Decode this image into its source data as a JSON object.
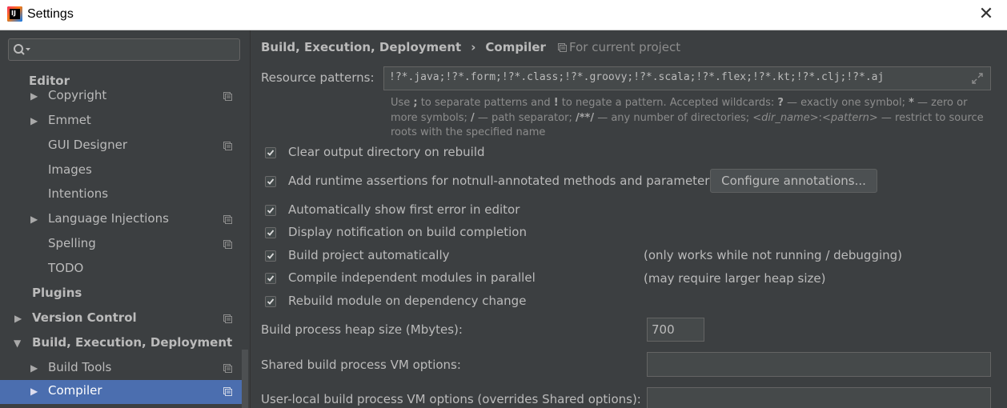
{
  "window": {
    "title": "Settings"
  },
  "search": {
    "placeholder": ""
  },
  "sidebar": {
    "items": [
      {
        "label": "Editor"
      },
      {
        "label": "Copyright"
      },
      {
        "label": "Emmet"
      },
      {
        "label": "GUI Designer"
      },
      {
        "label": "Images"
      },
      {
        "label": "Intentions"
      },
      {
        "label": "Language Injections"
      },
      {
        "label": "Spelling"
      },
      {
        "label": "TODO"
      },
      {
        "label": "Plugins"
      },
      {
        "label": "Version Control"
      },
      {
        "label": "Build, Execution, Deployment"
      },
      {
        "label": "Build Tools"
      },
      {
        "label": "Compiler"
      }
    ],
    "selected": "Compiler"
  },
  "breadcrumb": {
    "parent": "Build, Execution, Deployment",
    "separator": "›",
    "current": "Compiler",
    "scope": "For current project"
  },
  "compiler": {
    "resource_patterns_label": "Resource patterns:",
    "resource_patterns_value": "!?*.java;!?*.form;!?*.class;!?*.groovy;!?*.scala;!?*.flex;!?*.kt;!?*.clj;!?*.aj",
    "hint": {
      "p1": "Use ",
      "b1": ";",
      "p2": " to separate patterns and ",
      "b2": "!",
      "p3": " to negate a pattern. Accepted wildcards: ",
      "b3": "?",
      "p4": " — exactly one symbol; ",
      "b4": "*",
      "p5": " — zero or more symbols; ",
      "b5": "/",
      "p6": " — path separator; ",
      "b6": "/**/",
      "p7": " — any number of directories; ",
      "i1": "<dir_name>",
      "p8": ":",
      "i2": "<pattern>",
      "p9": " — restrict to source roots with the specified name"
    },
    "options": [
      {
        "label": "Clear output directory on rebuild",
        "checked": true
      },
      {
        "label": "Add runtime assertions for notnull-annotated methods and parameters",
        "checked": true
      },
      {
        "label": "Automatically show first error in editor",
        "checked": true
      },
      {
        "label": "Display notification on build completion",
        "checked": true
      },
      {
        "label": "Build project automatically",
        "checked": true
      },
      {
        "label": "Compile independent modules in parallel",
        "checked": true
      },
      {
        "label": "Rebuild module on dependency change",
        "checked": true
      }
    ],
    "configure_annotations_label": "Configure annotations...",
    "build_auto_note": "(only works while not running / debugging)",
    "parallel_note": "(may require larger heap size)",
    "heap_label": "Build process heap size (Mbytes):",
    "heap_value": "700",
    "shared_vm_label": "Shared build process VM options:",
    "shared_vm_value": "",
    "user_vm_label": "User-local build process VM options (overrides Shared options):",
    "user_vm_value": ""
  },
  "colors": {
    "background": "#3c3f41",
    "selection": "#4b6eaf",
    "text": "#bbbbbb",
    "hint_text": "#8c8c8c"
  }
}
